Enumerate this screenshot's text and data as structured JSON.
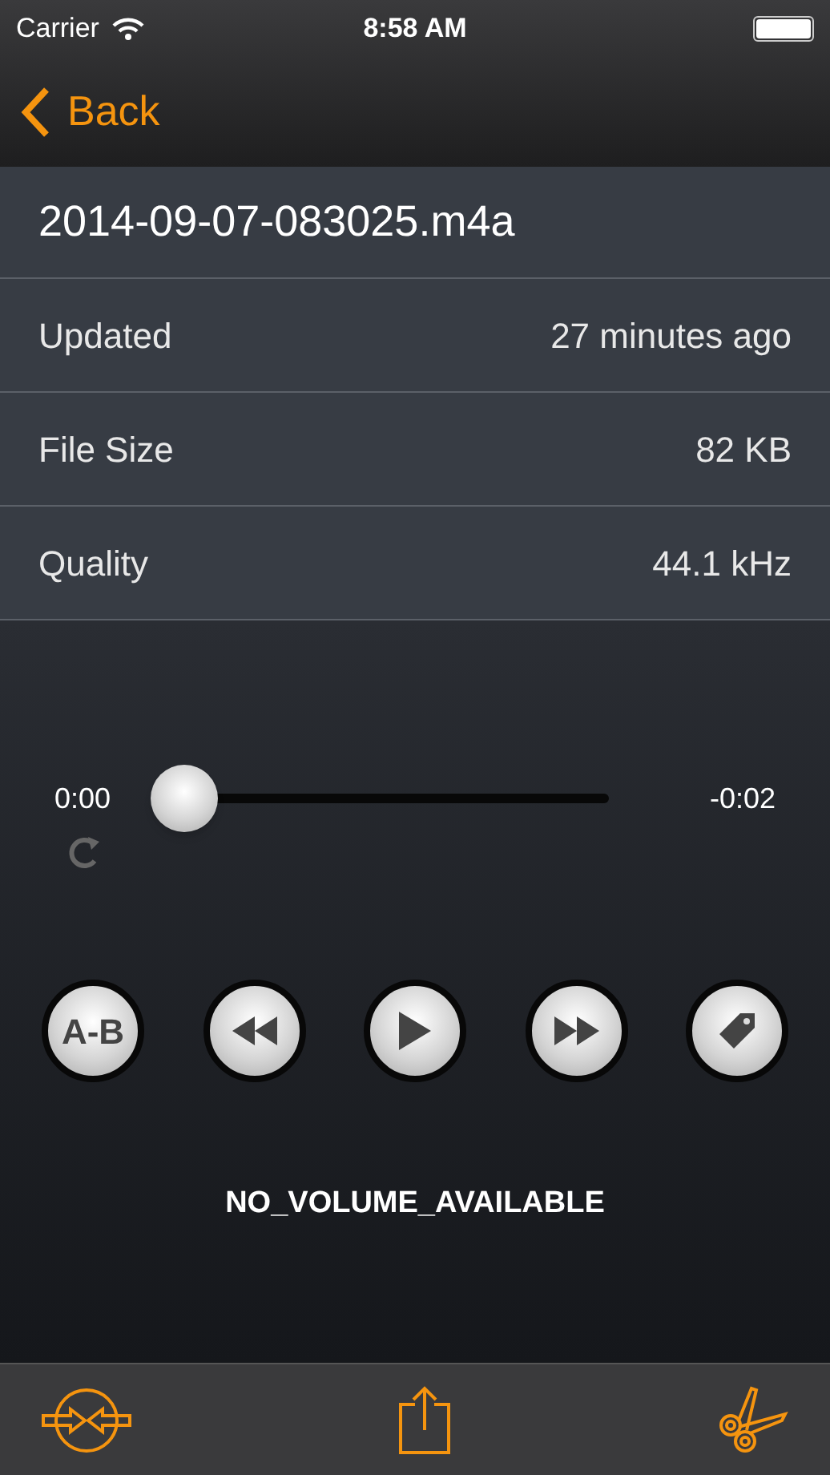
{
  "status_bar": {
    "carrier": "Carrier",
    "time": "8:58 AM"
  },
  "nav": {
    "back": "Back"
  },
  "file": {
    "title": "2014-09-07-083025.m4a"
  },
  "details": [
    {
      "label": "Updated",
      "value": "27 minutes ago"
    },
    {
      "label": "File Size",
      "value": "82 KB"
    },
    {
      "label": "Quality",
      "value": "44.1 kHz"
    }
  ],
  "player": {
    "elapsed": "0:00",
    "remaining": "-0:02",
    "level": 0,
    "controls": [
      {
        "kind": "ab",
        "label": "A-B"
      },
      {
        "kind": "rewind"
      },
      {
        "kind": "play"
      },
      {
        "kind": "forward"
      },
      {
        "kind": "tag"
      }
    ],
    "message": "NO_VOLUME_AVAILABLE"
  },
  "toolbar": [
    {
      "kind": "merge"
    },
    {
      "kind": "share"
    },
    {
      "kind": "trim"
    }
  ]
}
